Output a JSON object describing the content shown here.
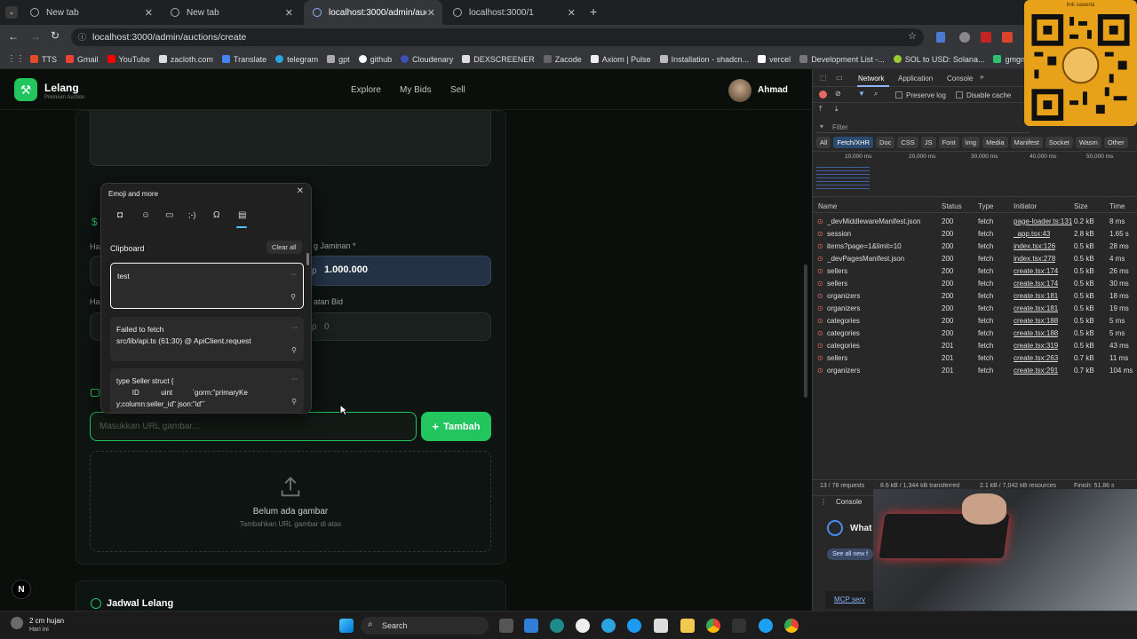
{
  "browser": {
    "tabs": [
      {
        "title": "New tab",
        "active": false
      },
      {
        "title": "New tab",
        "active": false
      },
      {
        "title": "localhost:3000/admin/auctions",
        "active": true
      },
      {
        "title": "localhost:3000/1",
        "active": false
      }
    ],
    "new_tab_symbol": "+",
    "url": "localhost:3000/admin/auctions/create",
    "bookmarks": [
      "TTS",
      "Gmail",
      "YouTube",
      "zacloth.com",
      "Translate",
      "telegram",
      "gpt",
      "github",
      "Cloudenary",
      "DEXSCREENER",
      "Zacode",
      "Axiom | Pulse",
      "Installation - shadcn...",
      "vercel",
      "Development List -...",
      "SOL to USD: Solana...",
      "gmgn"
    ]
  },
  "app": {
    "brand": "Lelang",
    "tagline": "Premium Auction",
    "nav": [
      "Explore",
      "My Bids",
      "Sell"
    ],
    "user": "Ahmad",
    "form": {
      "jaminan_label": "g Jaminan *",
      "jaminan_value": "1.000.000",
      "jaminan_prefix": "p",
      "kelipatan_label": "atan Bid",
      "kelipatan_value": "0",
      "kelipatan_prefix": "p",
      "partial_label_1": "Ha",
      "partial_label_2": "Ha",
      "dollar_partial": "$",
      "url_placeholder": "Masukkan URL gambar...",
      "add_button": "Tambah",
      "empty_title": "Belum ada gambar",
      "empty_subtitle": "Tambahkan URL gambar di atas",
      "schedule_title": "Jadwal Lelang"
    }
  },
  "emoji_panel": {
    "title": "Emoji and more",
    "section": "Clipboard",
    "clear_all": "Clear all",
    "items": [
      "test",
      "Failed to fetch\nsrc/lib/api.ts (61:30) @ ApiClient.request",
      "type Seller struct {\n        ID           uint          `gorm:\"primaryKe\ny;column:seller_id\" json:\"id\"`"
    ],
    "more_symbol": "···"
  },
  "devtools": {
    "tabs": [
      "Network",
      "Application",
      "Console"
    ],
    "preserve_log": "Preserve log",
    "disable_cache": "Disable cache",
    "filter_placeholder": "Filter",
    "type_filters": [
      "All",
      "Fetch/XHR",
      "Doc",
      "CSS",
      "JS",
      "Font",
      "Img",
      "Media",
      "Manifest",
      "Socket",
      "Wasm",
      "Other"
    ],
    "timeline_ticks": [
      "10,000 ms",
      "20,000 ms",
      "30,000 ms",
      "40,000 ms",
      "50,000 ms"
    ],
    "columns": [
      "Name",
      "Status",
      "Type",
      "Initiator",
      "Size",
      "Time"
    ],
    "rows": [
      [
        "_devMiddlewareManifest.json",
        "200",
        "fetch",
        "page-loader.ts:131",
        "0.2 kB",
        "8 ms"
      ],
      [
        "session",
        "200",
        "fetch",
        "_app.tsx:43",
        "2.8 kB",
        "1.65 s"
      ],
      [
        "items?page=1&limit=10",
        "200",
        "fetch",
        "index.tsx:126",
        "0.5 kB",
        "28 ms"
      ],
      [
        "_devPagesManifest.json",
        "200",
        "fetch",
        "index.tsx:278",
        "0.5 kB",
        "4 ms"
      ],
      [
        "sellers",
        "200",
        "fetch",
        "create.tsx:174",
        "0.5 kB",
        "26 ms"
      ],
      [
        "sellers",
        "200",
        "fetch",
        "create.tsx:174",
        "0.5 kB",
        "30 ms"
      ],
      [
        "organizers",
        "200",
        "fetch",
        "create.tsx:181",
        "0.5 kB",
        "18 ms"
      ],
      [
        "organizers",
        "200",
        "fetch",
        "create.tsx:181",
        "0.5 kB",
        "19 ms"
      ],
      [
        "categories",
        "200",
        "fetch",
        "create.tsx:188",
        "0.5 kB",
        "5 ms"
      ],
      [
        "categories",
        "200",
        "fetch",
        "create.tsx:188",
        "0.5 kB",
        "5 ms"
      ],
      [
        "categories",
        "201",
        "fetch",
        "create.tsx:319",
        "0.5 kB",
        "43 ms"
      ],
      [
        "sellers",
        "201",
        "fetch",
        "create.tsx:263",
        "0.7 kB",
        "11 ms"
      ],
      [
        "organizers",
        "201",
        "fetch",
        "create.tsx:291",
        "0.7 kB",
        "104 ms"
      ]
    ],
    "status_bar": [
      "13 / 78 requests",
      "8.6 kB / 1,344 kB transferred",
      "2.1 kB / 7,042 kB resources",
      "Finish: 51.86 s"
    ],
    "console_label": "Console",
    "whats_new": "What",
    "see_all": "See all new f",
    "mcp": "MCP serv"
  },
  "overlays": {
    "qr_caption": "link sawerla"
  },
  "taskbar": {
    "weather_temp": "2 cm hujan",
    "weather_sub": "Hari ini",
    "search": "Search"
  }
}
